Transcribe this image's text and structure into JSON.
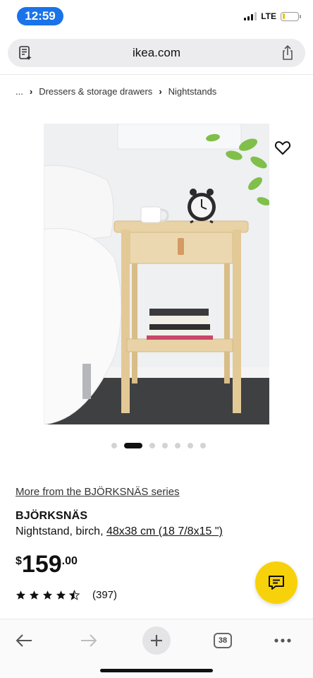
{
  "status_bar": {
    "time": "12:59",
    "network": "LTE",
    "battery_level": 0.15,
    "colors": {
      "time_pill": "#1a73e8",
      "battery": "#f2c200"
    }
  },
  "browser": {
    "url": "ikea.com",
    "tab_count": "38",
    "icons": {
      "reader": "reader-mode-icon",
      "share": "share-icon",
      "back": "back-arrow-icon",
      "forward": "forward-arrow-icon",
      "new_tab": "plus-icon",
      "tabs": "tabs-icon",
      "more": "more-dots-icon"
    }
  },
  "breadcrumb": {
    "items": [
      "...",
      "Dressers & storage drawers",
      "Nightstands"
    ]
  },
  "product": {
    "image_alt": "BJÖRKSNÄS nightstand with clock, cup and books",
    "carousel": {
      "count": 7,
      "active": 1
    },
    "series_link": "More from the BJÖRKSNÄS series",
    "name": "BJÖRKSNÄS",
    "description": "Nightstand, birch, ",
    "size": "48x38 cm (18 7/8x15 \")",
    "price": {
      "currency": "$",
      "whole": "159",
      "cents": ".00"
    },
    "rating": {
      "stars": 4.5,
      "review_count": "(397)"
    },
    "accent_color": "#f7d20a"
  }
}
